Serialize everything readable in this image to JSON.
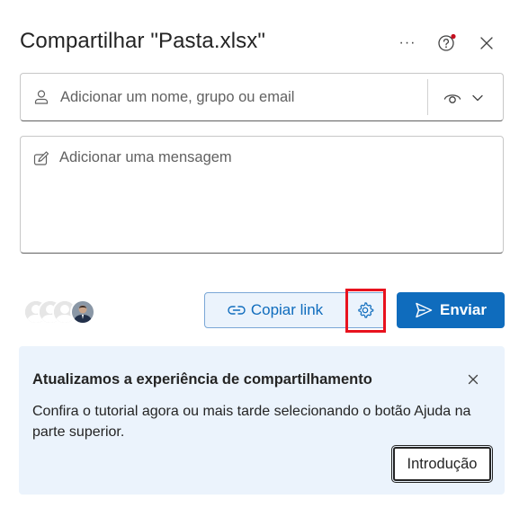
{
  "dialog": {
    "title": "Compartilhar \"Pasta.xlsx\"",
    "more_label": "···"
  },
  "recipients": {
    "placeholder": "Adicionar um nome, grupo ou email",
    "permission_icon": "eye-icon"
  },
  "message": {
    "placeholder": "Adicionar uma mensagem"
  },
  "actions": {
    "copy_link_label": "Copiar link",
    "send_label": "Enviar"
  },
  "banner": {
    "title": "Atualizamos a experiência de compartilhamento",
    "body": "Confira o tutorial agora ou mais tarde selecionando o botão Ajuda na parte superior.",
    "intro_label": "Introdução"
  },
  "colors": {
    "accent": "#0f6cbd",
    "highlight": "#e8121e",
    "banner_bg": "#ebf3fc",
    "notification_dot": "#c50f1f"
  }
}
